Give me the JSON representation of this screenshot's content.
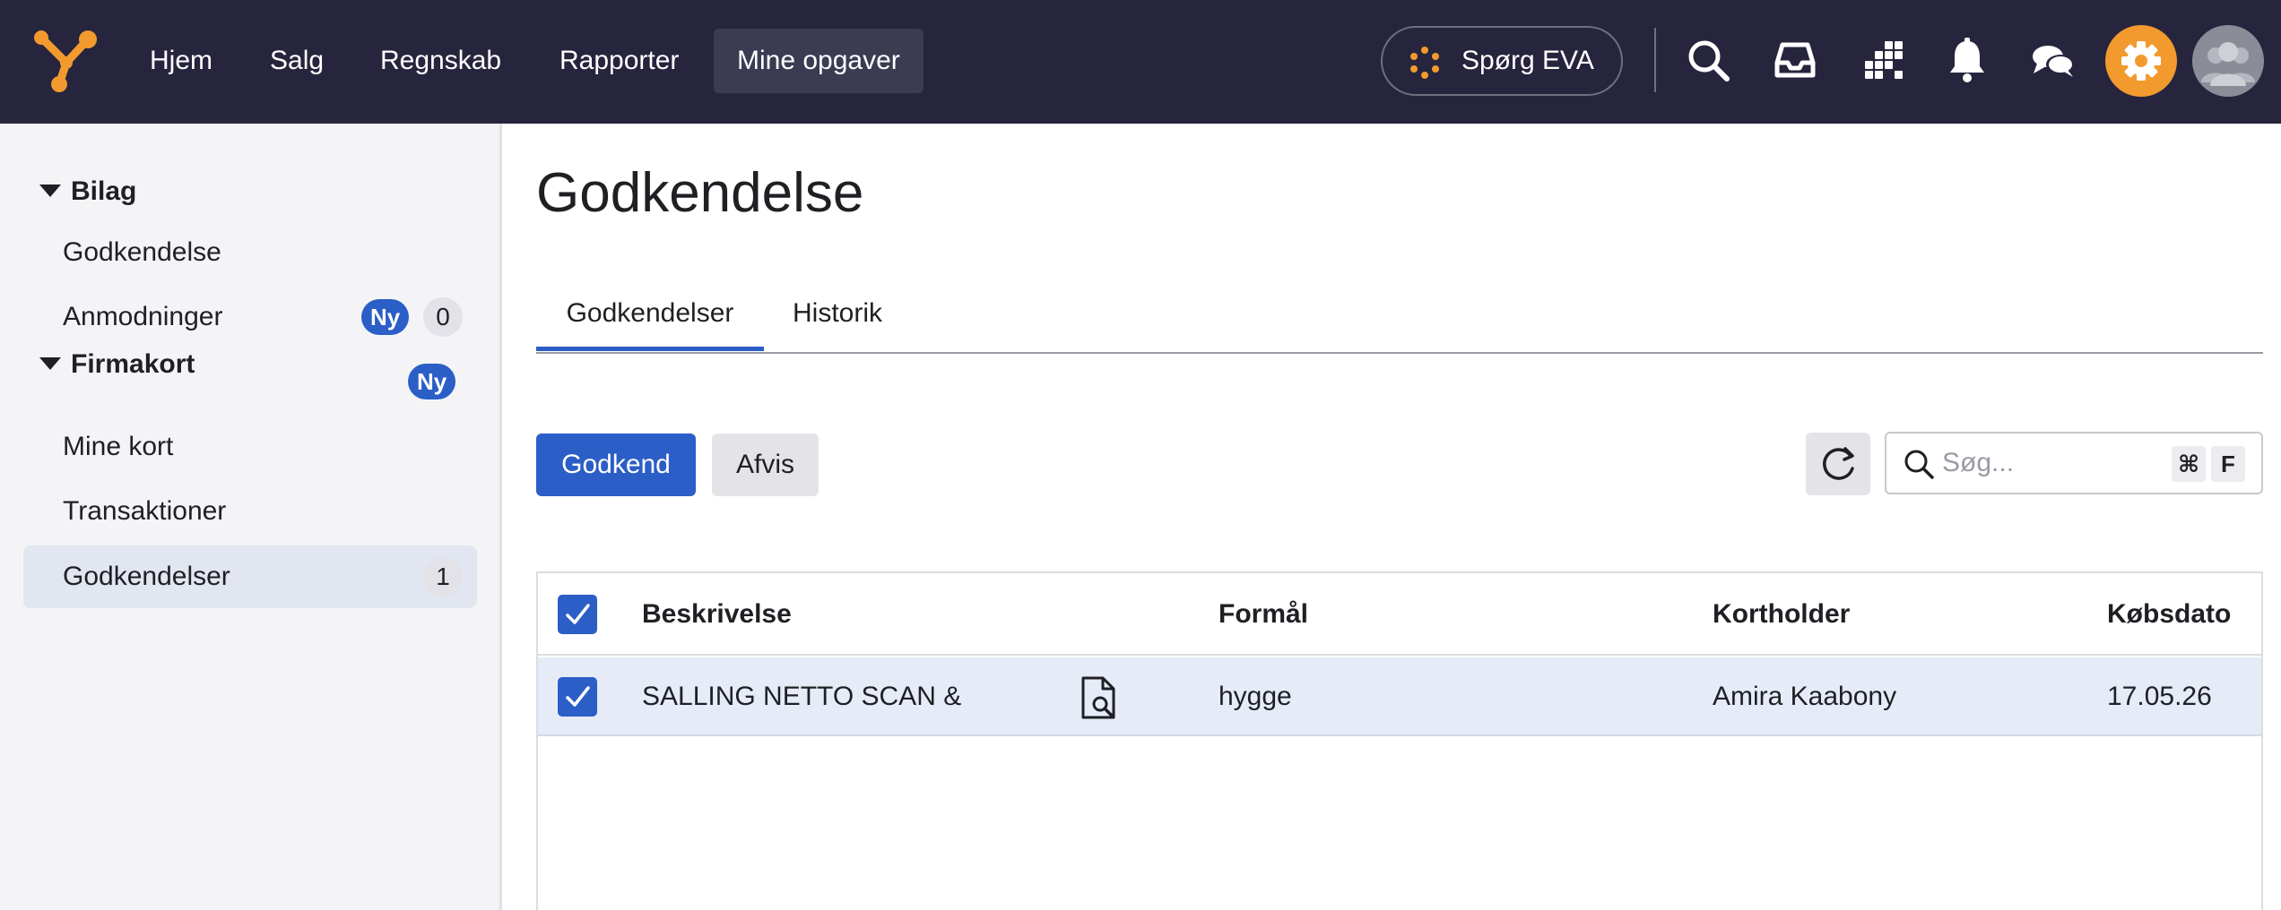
{
  "nav": {
    "items": [
      {
        "label": "Hjem"
      },
      {
        "label": "Salg"
      },
      {
        "label": "Regnskab"
      },
      {
        "label": "Rapporter"
      },
      {
        "label": "Mine opgaver"
      }
    ],
    "active_item": "Mine opgaver",
    "eva_label": "Spørg EVA",
    "icons": [
      "search-icon",
      "inbox-icon",
      "apps-icon",
      "bell-icon",
      "chat-icon",
      "gear-icon",
      "avatar"
    ],
    "brand_color": "#f29a2e",
    "bar_color": "#26253d"
  },
  "sidebar": {
    "sections": [
      {
        "label": "Bilag",
        "items": [
          {
            "label": "Godkendelse"
          },
          {
            "label": "Anmodninger",
            "badge": "Ny",
            "count": "0"
          }
        ]
      },
      {
        "label": "Firmakort",
        "badge": "Ny",
        "items": [
          {
            "label": "Mine kort"
          },
          {
            "label": "Transaktioner"
          },
          {
            "label": "Godkendelser",
            "count": "1",
            "active": true
          }
        ]
      }
    ]
  },
  "main": {
    "title": "Godkendelse",
    "tabs": [
      {
        "label": "Godkendelser",
        "active": true
      },
      {
        "label": "Historik"
      }
    ],
    "approve_label": "Godkend",
    "reject_label": "Afvis",
    "search": {
      "placeholder": "Søg...",
      "shortcut": [
        "⌘",
        "F"
      ]
    },
    "accent_color": "#2b5ec6"
  },
  "table": {
    "columns": [
      "Beskrivelse",
      "Formål",
      "Kortholder",
      "Købsdato"
    ],
    "rows": [
      {
        "checked": true,
        "description": "SALLING NETTO SCAN &",
        "purpose": "hygge",
        "cardholder": "Amira Kaabony",
        "date": "17.05.26"
      }
    ],
    "all_checked": true
  }
}
